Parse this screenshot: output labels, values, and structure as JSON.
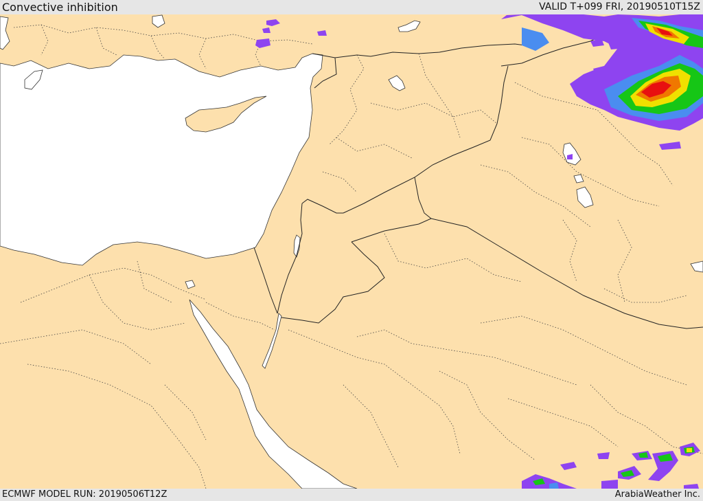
{
  "header": {
    "title": "Convective inhibition",
    "valid_time": "VALID T+099 FRI, 20190510T15Z"
  },
  "footer": {
    "model_run": "ECMWF MODEL RUN: 20190506T12Z",
    "credit": "ArabiaWeather Inc."
  },
  "map": {
    "land_color": "#fde0ad",
    "water_color": "#ffffff",
    "border_color": "#222222",
    "cin_colors": [
      "#8e44f0",
      "#4a8df0",
      "#16c616",
      "#f0e000",
      "#f07800",
      "#e81010"
    ]
  }
}
